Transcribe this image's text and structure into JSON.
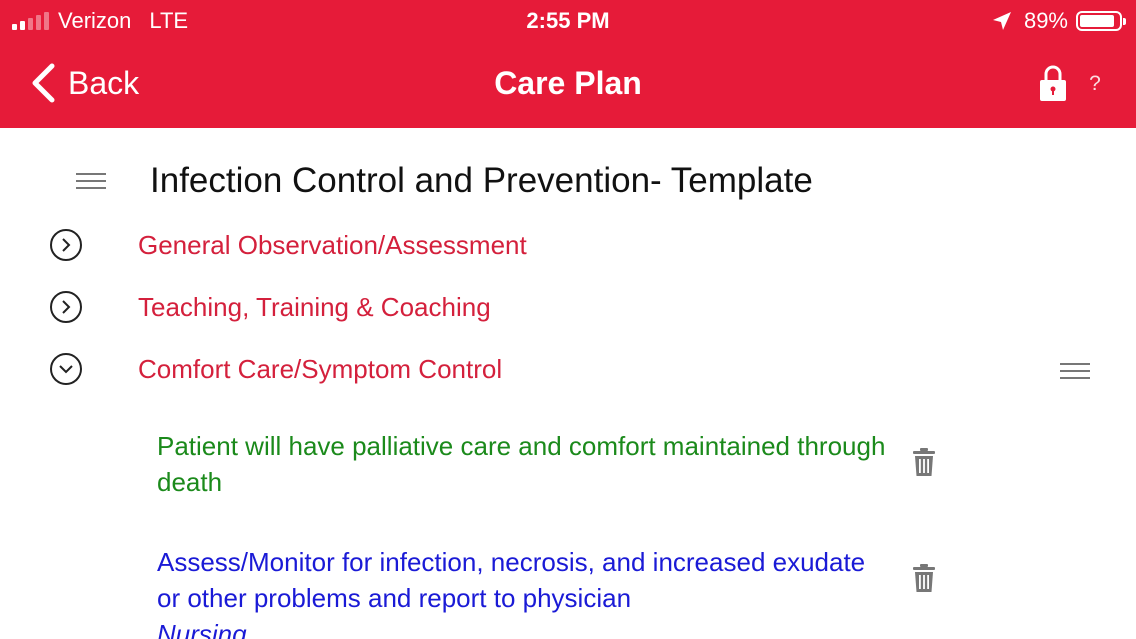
{
  "status_bar": {
    "carrier": "Verizon",
    "network": "LTE",
    "time": "2:55 PM",
    "battery_percent": "89%",
    "battery_level": 0.89,
    "signal_bars": 2
  },
  "nav": {
    "back_label": "Back",
    "title": "Care Plan",
    "help_label": "?"
  },
  "page": {
    "title": "Infection Control and Prevention- Template"
  },
  "sections": [
    {
      "label": "General Observation/Assessment",
      "expanded": false
    },
    {
      "label": "Teaching, Training & Coaching",
      "expanded": false
    },
    {
      "label": "Comfort Care/Symptom Control",
      "expanded": true
    }
  ],
  "items": [
    {
      "type": "goal",
      "text": "Patient will have palliative care and comfort maintained through death"
    },
    {
      "type": "intervention",
      "text": "Assess/Monitor for infection, necrosis, and increased exudate or other problems and report to physician",
      "discipline": "Nursing"
    }
  ],
  "colors": {
    "header_red": "#e61b39",
    "section_red": "#d4203c",
    "goal_green": "#1b8a1b",
    "intervention_blue": "#1a1ad6"
  },
  "icons": [
    "back-chevron-icon",
    "location-arrow-icon",
    "battery-icon",
    "lock-icon",
    "hamburger-menu-icon",
    "chevron-right-circle-icon",
    "chevron-down-circle-icon",
    "trash-icon"
  ]
}
